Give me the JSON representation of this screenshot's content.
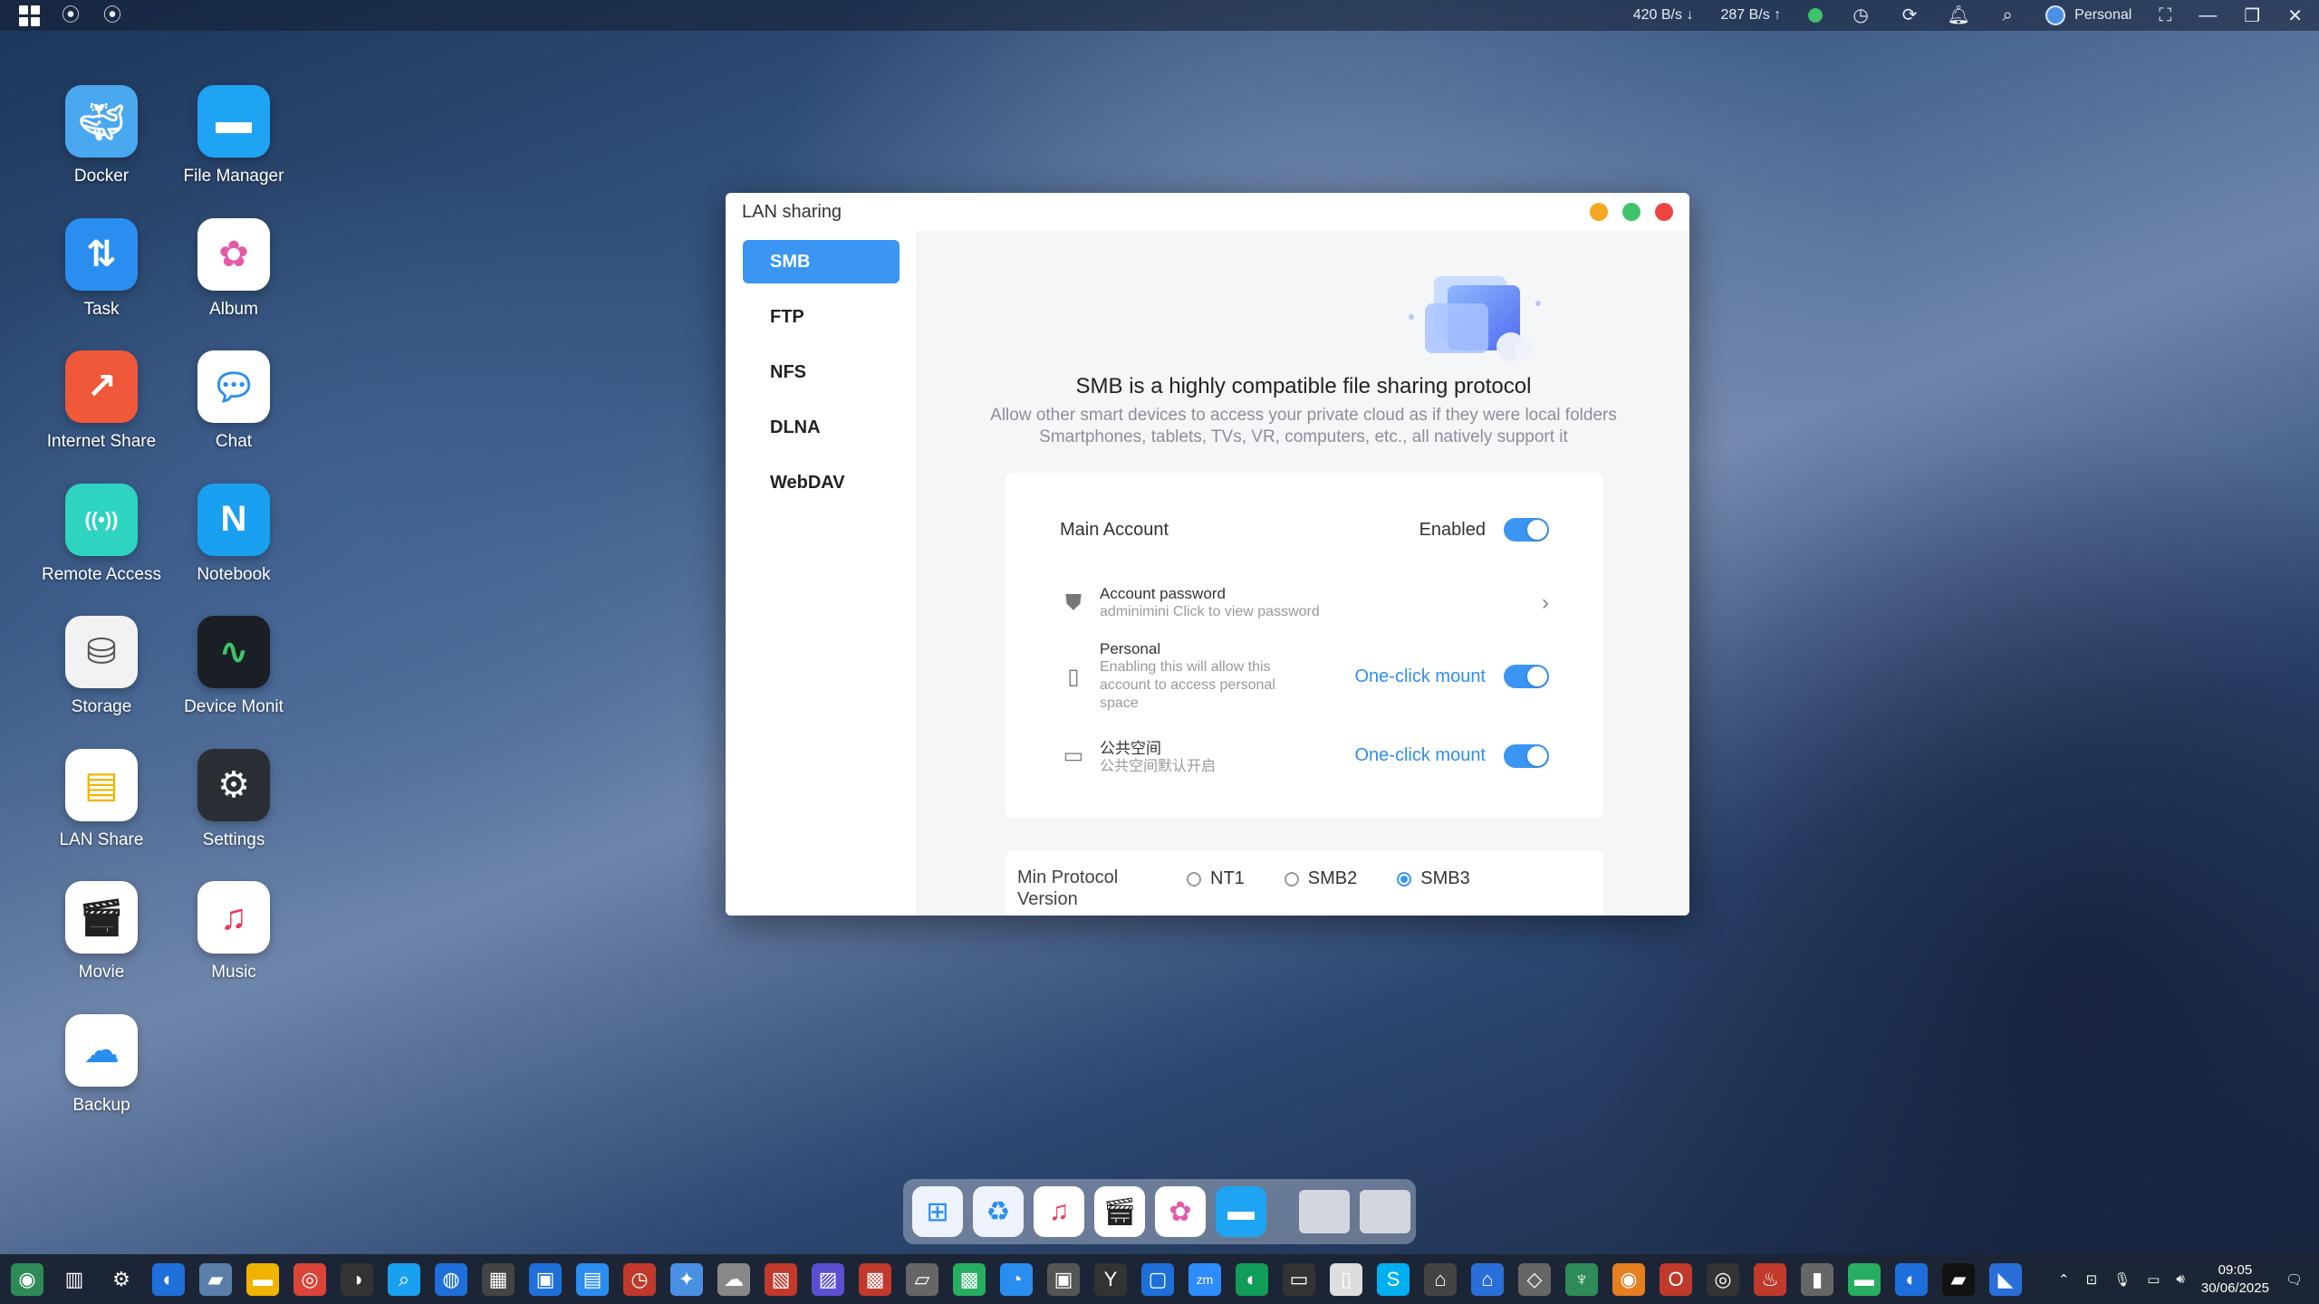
{
  "topbar": {
    "download_speed": "420 B/s ↓",
    "upload_speed": "287 B/s ↑",
    "profile_name": "Personal"
  },
  "desktop_icons": [
    {
      "label": "Docker",
      "icon": "docker-icon",
      "color": "#4aa8f0"
    },
    {
      "label": "File Manager",
      "icon": "folder-icon",
      "color": "#1ea4f2"
    },
    {
      "label": "Task",
      "icon": "task-icon",
      "color": "#2a8ef0"
    },
    {
      "label": "Album",
      "icon": "album-icon",
      "color": "#ffffff"
    },
    {
      "label": "Internet Share",
      "icon": "internet-share-icon",
      "color": "#f0583a"
    },
    {
      "label": "Chat",
      "icon": "chat-icon",
      "color": "#ffffff"
    },
    {
      "label": "Remote Access",
      "icon": "remote-access-icon",
      "color": "#2ed4c0"
    },
    {
      "label": "Notebook",
      "icon": "notebook-icon",
      "color": "#1aa0f0"
    },
    {
      "label": "Storage",
      "icon": "storage-icon",
      "color": "#f2f2f2"
    },
    {
      "label": "Device Monit",
      "icon": "device-monitor-icon",
      "color": "#1a1f25"
    },
    {
      "label": "LAN Share",
      "icon": "lan-share-icon",
      "color": "#ffffff"
    },
    {
      "label": "Settings",
      "icon": "settings-icon",
      "color": "#2a2f36"
    },
    {
      "label": "Movie",
      "icon": "movie-icon",
      "color": "#ffffff"
    },
    {
      "label": "Music",
      "icon": "music-icon",
      "color": "#ffffff"
    },
    {
      "label": "Backup",
      "icon": "backup-icon",
      "color": "#ffffff"
    }
  ],
  "window": {
    "title": "LAN sharing",
    "sidebar": [
      {
        "label": "SMB",
        "active": true
      },
      {
        "label": "FTP",
        "active": false
      },
      {
        "label": "NFS",
        "active": false
      },
      {
        "label": "DLNA",
        "active": false
      },
      {
        "label": "WebDAV",
        "active": false
      }
    ],
    "heading": "SMB is a highly compatible file sharing protocol",
    "subtext_line1": "Allow other smart devices to access your private cloud as if they were local folders",
    "subtext_line2": "Smartphones, tablets, TVs, VR, computers, etc., all natively support it",
    "main_account": {
      "label": "Main Account",
      "status": "Enabled"
    },
    "account_password": {
      "title": "Account password",
      "desc": "adminimini Click to view password"
    },
    "personal": {
      "title": "Personal",
      "desc": "Enabling this will allow this account to access personal space",
      "action": "One-click mount"
    },
    "public_space": {
      "title": "公共空间",
      "desc": "公共空间默认开启",
      "action": "One-click mount"
    },
    "protocol": {
      "label": "Min Protocol Version",
      "options": [
        "NT1",
        "SMB2",
        "SMB3"
      ],
      "selected": "SMB3"
    }
  },
  "taskbar": {
    "time": "09:05",
    "date": "30/06/2025"
  },
  "colors": {
    "accent": "#3a95f3",
    "traffic_yellow": "#f5a623",
    "traffic_green": "#3ec36a",
    "traffic_red": "#ef4444"
  }
}
